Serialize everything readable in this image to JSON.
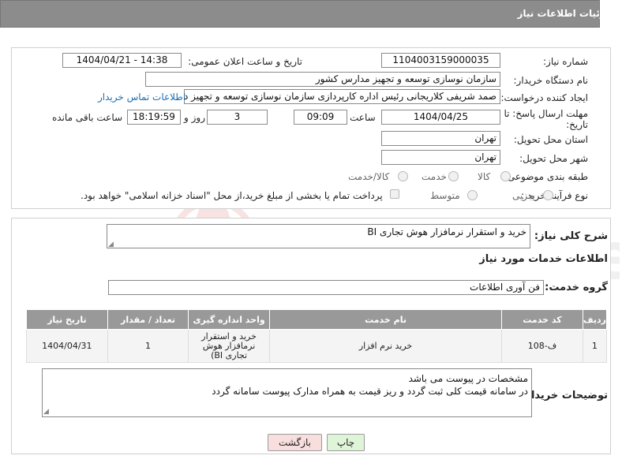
{
  "header": {
    "title": "جزئیات اطلاعات نیاز"
  },
  "form": {
    "need_number_label": "شماره نیاز:",
    "need_number": "1104003159000035",
    "announce_label": "تاریخ و ساعت اعلان عمومی:",
    "announce_value": "1404/04/21 - 14:38",
    "buyer_org_label": "نام دستگاه خریدار:",
    "buyer_org": "سازمان نوسازی  توسعه و تجهیز مدارس کشور",
    "creator_label": "ایجاد کننده درخواست:",
    "creator": "صمد شریفی کلاریجانی رئیس اداره کارپردازی سازمان نوسازی  توسعه و تجهیز د",
    "contact_link": "اطلاعات تماس خریدار",
    "deadline_label_1": "مهلت ارسال پاسخ: تا",
    "deadline_label_2": "تاریخ:",
    "deadline_date": "1404/04/25",
    "time_label": "ساعت",
    "deadline_time": "09:09",
    "days_value": "3",
    "days_label": "روز و",
    "remaining_value": "18:19:59",
    "remaining_label": "ساعت باقی مانده",
    "province_label": "استان محل تحویل:",
    "province": "تهران",
    "city_label": "شهر محل تحویل:",
    "city": "تهران",
    "category_label": "طبقه بندی موضوعی:",
    "category_options": [
      "کالا",
      "خدمت",
      "کالا/خدمت"
    ],
    "purchase_type_label": "نوع فرآیند خرید :",
    "purchase_type_options": [
      "جزیی",
      "متوسط"
    ],
    "treasury_note": "پرداخت تمام یا بخشی از مبلغ خرید،از محل \"اسناد خزانه اسلامی\" خواهد بود."
  },
  "need": {
    "summary_label": "شرح کلی نیاز:",
    "summary": "خرید و استقرار نرمافزار هوش تجاری BI",
    "services_title": "اطلاعات خدمات مورد نیاز",
    "group_label": "گروه خدمت:",
    "group": "فن آوری اطلاعات"
  },
  "table": {
    "headers": [
      "ردیف",
      "کد خدمت",
      "نام خدمت",
      "واحد اندازه گیری",
      "تعداد / مقدار",
      "تاریخ نیاز"
    ],
    "rows": [
      {
        "row": "1",
        "code": "ف-108",
        "name": "خرید نرم افزار",
        "unit": "خرید و استقرار نرمافزار هوش تجاری BI)",
        "unit_tail": ")",
        "qty": "1",
        "date": "1404/04/31"
      }
    ]
  },
  "buyer_notes": {
    "label": "توضیحات خریدار:",
    "line1": "مشخصات در پیوست می باشد",
    "line2": "در سامانه قیمت کلی ثبت گردد و ریز قیمت به همراه مدارک پیوست سامانه گردد"
  },
  "buttons": {
    "print": "چاپ",
    "back": "بازگشت"
  },
  "colors": {
    "header_bg": "#8c8c8c",
    "link": "#1a6fb5",
    "print_bg": "#dff5d8",
    "back_bg": "#f9dede"
  }
}
